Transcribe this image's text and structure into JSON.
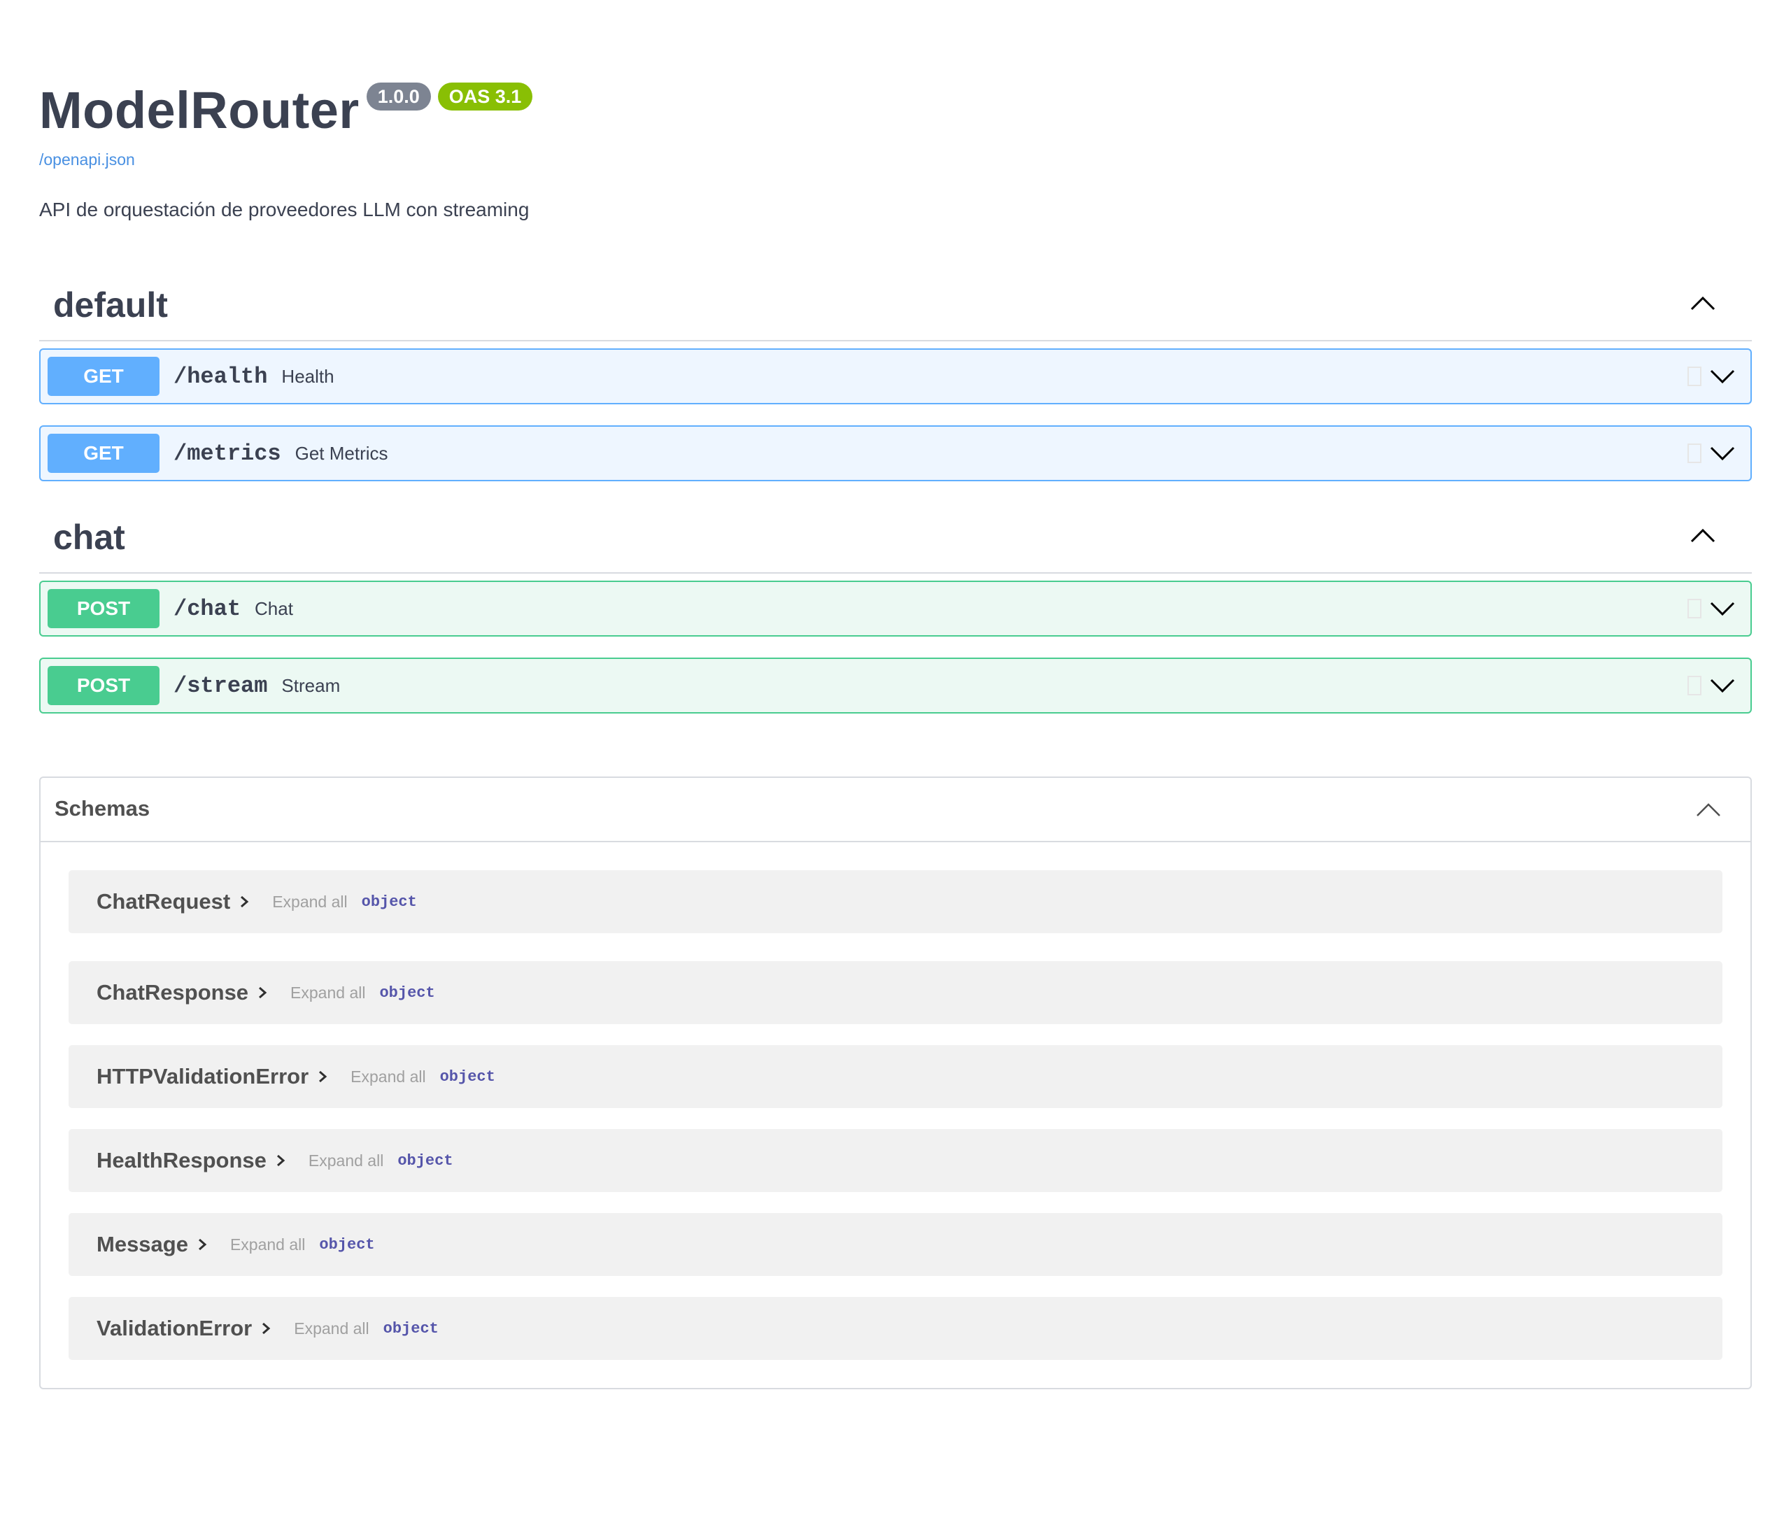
{
  "info": {
    "title": "ModelRouter",
    "version": "1.0.0",
    "oas": "OAS 3.1",
    "spec_link": "/openapi.json",
    "description": "API de orquestación de proveedores LLM con streaming"
  },
  "tags": [
    {
      "name": "default",
      "operations": [
        {
          "method": "GET",
          "path": "/health",
          "summary": "Health"
        },
        {
          "method": "GET",
          "path": "/metrics",
          "summary": "Get Metrics"
        }
      ]
    },
    {
      "name": "chat",
      "operations": [
        {
          "method": "POST",
          "path": "/chat",
          "summary": "Chat"
        },
        {
          "method": "POST",
          "path": "/stream",
          "summary": "Stream"
        }
      ]
    }
  ],
  "schemas": {
    "title": "Schemas",
    "expand_label": "Expand all",
    "items": [
      {
        "name": "ChatRequest",
        "type": "object"
      },
      {
        "name": "ChatResponse",
        "type": "object"
      },
      {
        "name": "HTTPValidationError",
        "type": "object"
      },
      {
        "name": "HealthResponse",
        "type": "object"
      },
      {
        "name": "Message",
        "type": "object"
      },
      {
        "name": "ValidationError",
        "type": "object"
      }
    ]
  },
  "colors": {
    "get": "#61affe",
    "post": "#49cc90",
    "version_badge": "#7d8492",
    "oas_badge": "#89bf04",
    "link": "#4990e2"
  },
  "icons": {
    "tag_toggle": "chevron-up-icon",
    "op_toggle": "chevron-down-icon",
    "copy": "copy-icon",
    "model_expand": "chevron-right-icon"
  }
}
